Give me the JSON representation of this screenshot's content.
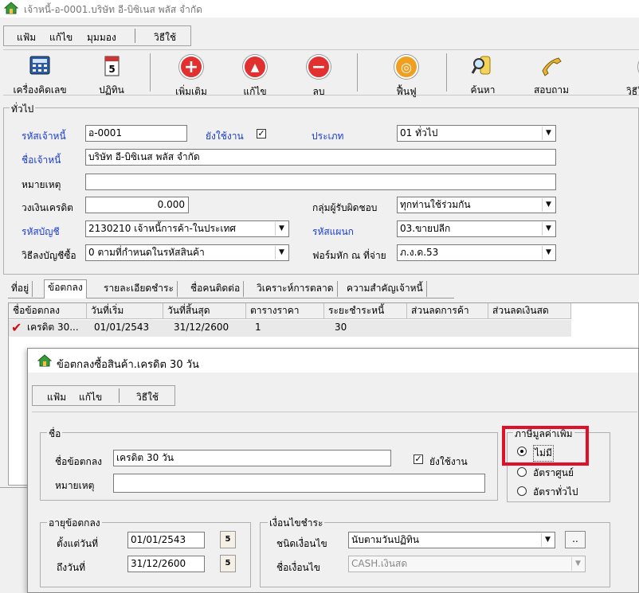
{
  "window": {
    "title": "เจ้าหนี้-อ-0001.บริษัท อี-บิซิเนส พลัส จำกัด"
  },
  "menu": {
    "file": "แฟ้ม",
    "edit": "แก้ไข",
    "view": "มุมมอง",
    "help": "วิธีใช้"
  },
  "toolbar": {
    "calculator": "เครื่องคิดเลข",
    "calendar": "ปฏิทิน",
    "add": "เพิ่มเติม",
    "edit": "แก้ไข",
    "delete": "ลบ",
    "restore": "ฟื้นฟู",
    "search": "ค้นหา",
    "inquiry": "สอบถาม",
    "help": "วิธีใ",
    "calendar_day": "5"
  },
  "general": {
    "title": "ทั่วไป",
    "code_label": "รหัสเจ้าหนี้",
    "code_value": "อ-0001",
    "active_label": "ยังใช้งาน",
    "type_label": "ประเภท",
    "type_value": "01 ทั่วไป",
    "name_label": "ชื่อเจ้าหนี้",
    "name_value": "บริษัท อี-บิซิเนส พลัส จำกัด",
    "note_label": "หมายเหตุ",
    "note_value": "",
    "credit_label": "วงเงินเครดิต",
    "credit_value": "0.000",
    "resp_label": "กลุ่มผู้รับผิดชอบ",
    "resp_value": "ทุกท่านใช้ร่วมกัน",
    "account_label": "รหัสบัญชี",
    "account_value": "2130210 เจ้าหนี้การค้า-ในประเทศ",
    "dept_label": "รหัสแผนก",
    "dept_value": "03.ขายปลีก",
    "posting_label": "วิธีลงบัญชีซื้อ",
    "posting_value": "0 ตามที่กำหนดในรหัสสินค้า",
    "wht_label": "ฟอร์มหัก ณ ที่จ่าย",
    "wht_value": "ภ.ง.ด.53"
  },
  "tabs": [
    "ที่อยู่",
    "ข้อตกลง",
    "รายละเอียดชำระ",
    "ชื่อคนติดต่อ",
    "วิเคราะห์การตลาด",
    "ความสำคัญเจ้าหนี้"
  ],
  "grid": {
    "headers": [
      "ชื่อข้อตกลง",
      "วันที่เริ่ม",
      "วันที่สิ้นสุด",
      "ตารางราคา",
      "ระยะชำระหนี้",
      "ส่วนลดการค้า",
      "ส่วนลดเงินสด"
    ],
    "row": [
      "เครดิต 30...",
      "01/01/2543",
      "31/12/2600",
      "1",
      "30",
      "",
      ""
    ],
    "row_mark": "✔"
  },
  "dialog": {
    "title": "ข้อตกลงซื้อสินค้า.เครดิต 30 วัน",
    "menu_file": "แฟ้ม",
    "menu_edit": "แก้ไข",
    "menu_help": "วิธีใช้",
    "name_group": "ชื่อ",
    "agreement_label": "ชื่อข้อตกลง",
    "agreement_value": "เครดิต 30 วัน",
    "active_label": "ยังใช้งาน",
    "note_label": "หมายเหตุ",
    "note_value": "",
    "vat_group": "ภาษีมูลค่าเพิ่ม",
    "vat_none": "ไม่มี",
    "vat_zero": "อัตราศูนย์",
    "vat_normal": "อัตราทั่วไป",
    "age_group": "อายุข้อตกลง",
    "from_label": "ตั้งแต่วันที่",
    "from_value": "01/01/2543",
    "to_label": "ถึงวันที่",
    "to_value": "31/12/2600",
    "cond_group": "เงื่อนไขชำระ",
    "cond_type_label": "ชนิดเงื่อนไข",
    "cond_type_value": "นับตามวันปฏิทิน",
    "cond_name_label": "ชื่อเงื่อนไข",
    "cond_name_value": "CASH.เงินสด",
    "ellipsis": "..",
    "calendar_day": "5"
  },
  "colors": {
    "blue_label": "#1a3cc8",
    "highlight": "#e0102a"
  }
}
